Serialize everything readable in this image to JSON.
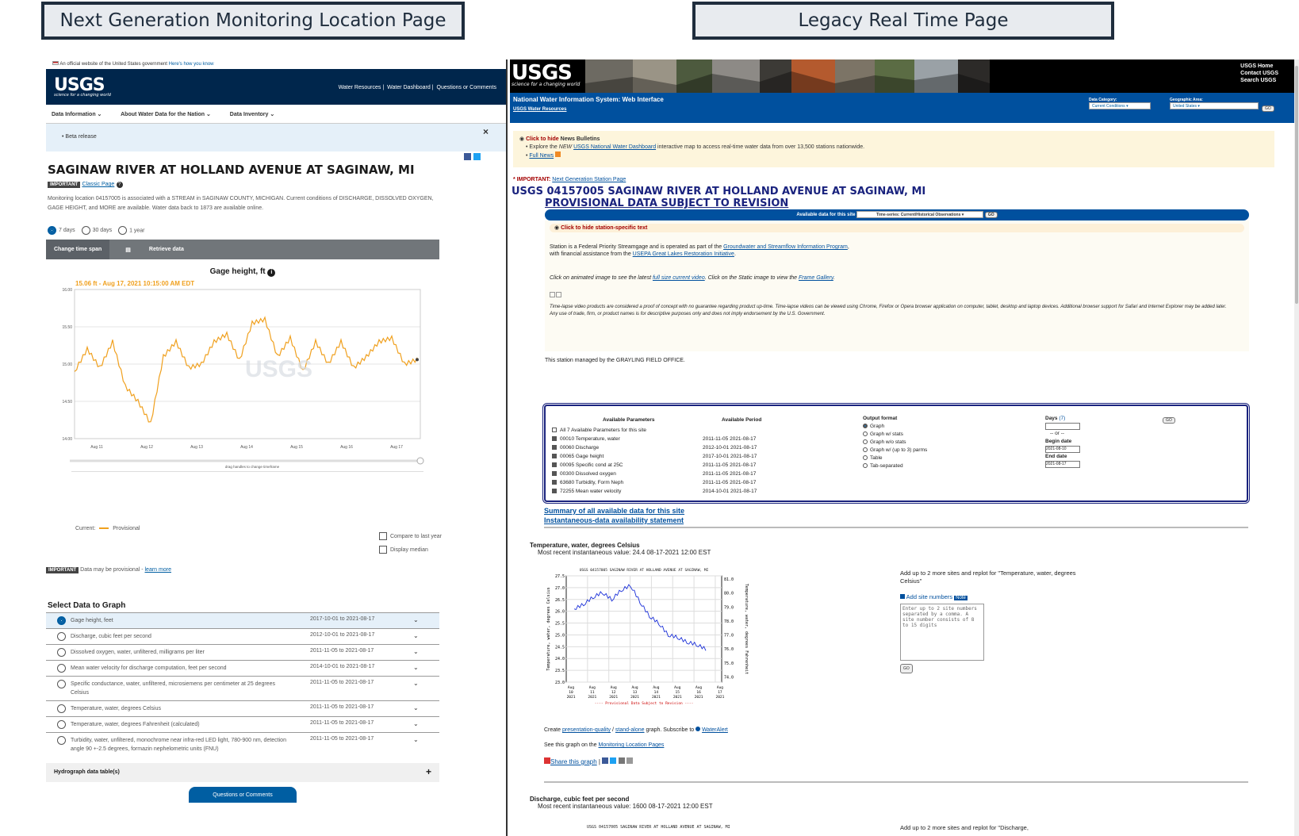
{
  "header_titles": {
    "left": "Next Generation Monitoring Location Page",
    "right": "Legacy Real Time Page"
  },
  "left": {
    "gov_banner": "An official website of the United States government",
    "gov_link": "Here's how you know",
    "logo": "USGS",
    "tagline": "science for a changing world",
    "header_links": [
      "Water Resources",
      "Water Dashboard",
      "Questions or Comments"
    ],
    "sub_nav": [
      "Data Information ⌄",
      "About Water Data for the Nation ⌄",
      "Data Inventory ⌄"
    ],
    "beta": "Beta release",
    "close": "×",
    "title": "SAGINAW RIVER AT HOLLAND AVENUE AT SAGINAW, MI",
    "important": "IMPORTANT",
    "classic_link": "Classic Page",
    "description": "Monitoring location 04157005 is associated with a STREAM in SAGINAW COUNTY, MICHIGAN. Current conditions of DISCHARGE, DISSOLVED OXYGEN, GAGE HEIGHT, and MORE are available. Water data back to 1873 are available online.",
    "time_options": [
      "7 days",
      "30 days",
      "1 year"
    ],
    "change_span": "Change time span",
    "retrieve": "Retrieve data",
    "graph_title": "Gage height, ft",
    "tooltip": "15.06 ft - Aug 17, 2021 10:15:00 AM EDT",
    "y_ticks": [
      "16.00",
      "15.50",
      "15.00",
      "14.50",
      "14.00"
    ],
    "x_ticks": [
      "Aug 11",
      "Aug 12",
      "Aug 13",
      "Aug 14",
      "Aug 15",
      "Aug 16",
      "Aug 17"
    ],
    "drag_hint": "drag handles to change timeframe",
    "legend_current": "Current:",
    "legend_provisional": "Provisional",
    "compare": "Compare to last year",
    "median": "Display median",
    "provisional_note": "Data may be provisional -",
    "learn_more": "learn more",
    "select_heading": "Select Data to Graph",
    "params": [
      {
        "name": "Gage height, feet",
        "period": "2017-10-01 to 2021-08-17"
      },
      {
        "name": "Discharge, cubic feet per second",
        "period": "2012-10-01 to 2021-08-17"
      },
      {
        "name": "Dissolved oxygen, water, unfiltered, milligrams per liter",
        "period": "2011-11-05 to 2021-08-17"
      },
      {
        "name": "Mean water velocity for discharge computation, feet per second",
        "period": "2014-10-01 to 2021-08-17"
      },
      {
        "name": "Specific conductance, water, unfiltered, microsiemens per centimeter at 25 degrees Celsius",
        "period": "2011-11-05 to 2021-08-17"
      },
      {
        "name": "Temperature, water, degrees Celsius",
        "period": "2011-11-05 to 2021-08-17"
      },
      {
        "name": "Temperature, water, degrees Fahrenheit (calculated)",
        "period": "2011-11-05 to 2021-08-17"
      },
      {
        "name": "Turbidity, water, unfiltered, monochrome near infra-red LED light, 780-900 nm, detection angle 90 +-2.5 degrees, formazin nephelometric units (FNU)",
        "period": "2011-11-05 to 2021-08-17"
      }
    ],
    "hydrograph": "Hydrograph data table(s)",
    "questions": "Questions or Comments",
    "colors": {
      "navy": "#00264c",
      "line": "#f0a01e",
      "accent": "#005ea2"
    }
  },
  "right": {
    "logo": "USGS",
    "tagline": "science for a changing world",
    "top_links": [
      "USGS Home",
      "Contact USGS",
      "Search USGS"
    ],
    "nwis": "National Water Information System: Web Interface",
    "water_resources": "USGS Water Resources",
    "data_category_label": "Data Category:",
    "data_category": "Current Conditions",
    "geo_label": "Geographic Area:",
    "geo": "United States",
    "go": "GO",
    "news_toggle": "Click to hide",
    "news_label": "News Bulletins",
    "news_1a": "Explore the",
    "news_1b": "NEW",
    "news_1c": "USGS National Water Dashboard",
    "news_1d": "interactive map to access real-time water data from over 13,500 stations nationwide.",
    "news_full": "Full News",
    "important": "* IMPORTANT:",
    "next_gen": "Next Generation Station Page",
    "station_title": "USGS 04157005 SAGINAW RIVER AT HOLLAND AVENUE AT SAGINAW, MI",
    "provisional": "PROVISIONAL DATA SUBJECT TO REVISION",
    "available_label": "Available data for this site",
    "available_select": "Time-series: Current/Historical Observations",
    "hide_station": "Click to hide station-specific text",
    "station_text_1": "Station is a Federal Priority Streamgage and is operated as part of the",
    "station_link_1": "Groundwater and Streamflow Information Program",
    "station_text_2": "with financial assistance from the",
    "station_link_2": "USEPA Great Lakes Restoration Initiative",
    "animated_1": "Click on animated image to see the latest",
    "animated_link": "full size current video",
    "animated_2": ". Click on the Static image to view the",
    "frame_link": "Frame Gallery",
    "disclaimer": "Time-lapse video products are considered a proof of concept with no guarantee regarding product up-time. Time-lapse videos can be viewed using Chrome, Firefox or Opera browser application on computer, tablet, desktop and laptop devices. Additional browser support for Safari and Internet Explorer may be added later. Any use of trade, firm, or product names is for descriptive purposes only and does not imply endorsement by the U.S. Government.",
    "managed": "This station managed by the GRAYLING FIELD OFFICE.",
    "table_headers": [
      "Available Parameters",
      "Available Period"
    ],
    "all_params": "All 7 Available Parameters for this site",
    "table_rows": [
      {
        "code": "00010 Temperature, water",
        "period": "2011-11-05  2021-08-17"
      },
      {
        "code": "00060 Discharge",
        "period": "2012-10-01  2021-08-17"
      },
      {
        "code": "00065 Gage height",
        "period": "2017-10-01  2021-08-17"
      },
      {
        "code": "00095 Specific cond at 25C",
        "period": "2011-11-05  2021-08-17"
      },
      {
        "code": "00300 Dissolved oxygen",
        "period": "2011-11-05  2021-08-17"
      },
      {
        "code": "63680 Turbidity, Form Neph",
        "period": "2011-11-05  2021-08-17"
      },
      {
        "code": "72255 Mean water velocity",
        "period": "2014-10-01  2021-08-17"
      }
    ],
    "output_format": "Output format",
    "formats": [
      "Graph",
      "Graph w/ stats",
      "Graph w/o stats",
      "Graph w/ (up to 3) parms",
      "Table",
      "Tab-separated"
    ],
    "days_label": "Days",
    "days_hint": "(7)",
    "or": "-- or --",
    "begin_label": "Begin date",
    "begin": "2021-08-10",
    "end_label": "End date",
    "end": "2021-08-17",
    "summary_link": "Summary of all available data for this site",
    "inst_link": "Instantaneous-data availability statement",
    "temp_title": "Temperature, water, degrees Celsius",
    "temp_recent": "Most recent instantaneous value: 24.4  08-17-2021    12:00 EST",
    "temp_chart_title": "USGS 04157005 SAGINAW RIVER AT HOLLAND AVENUE AT SAGINAW, MI",
    "temp_ylabel_left": "Temperature, water, degrees Celsius",
    "temp_ylabel_right": "Temperature, water, degrees Fahrenheit",
    "temp_y_left": [
      "27.5",
      "27.0",
      "26.5",
      "26.0",
      "25.5",
      "25.0",
      "24.5",
      "24.0",
      "23.5",
      "23.0"
    ],
    "temp_y_right": [
      "81.0",
      "80.0",
      "79.0",
      "78.0",
      "77.0",
      "76.0",
      "75.0",
      "74.0"
    ],
    "temp_x": [
      [
        "Aug",
        "10",
        "2021"
      ],
      [
        "Aug",
        "11",
        "2021"
      ],
      [
        "Aug",
        "12",
        "2021"
      ],
      [
        "Aug",
        "13",
        "2021"
      ],
      [
        "Aug",
        "14",
        "2021"
      ],
      [
        "Aug",
        "15",
        "2021"
      ],
      [
        "Aug",
        "16",
        "2021"
      ],
      [
        "Aug",
        "17",
        "2021"
      ]
    ],
    "prov_note": "---- Provisional Data Subject to Revision ----",
    "create_1": "Create",
    "create_link1": "presentation-quality",
    "create_sep": "/",
    "create_link2": "stand-alone",
    "create_2": "graph.   Subscribe to",
    "wateralert": "WaterAlert",
    "see_graph": "See this graph on the",
    "mlp_link": "Monitoring Location Pages",
    "share": "Share this graph",
    "add_sites_1": "Add up to 2 more sites and replot for \"Temperature, water, degrees Celsius\"",
    "add_site_numbers": "Add site numbers",
    "note": "Note",
    "textarea_placeholder": "Enter up to 2 site numbers separated by a comma. A site number consists of 8 to 15 digits",
    "disch_title": "Discharge, cubic feet per second",
    "disch_recent": "Most recent instantaneous value: 1600  08-17-2021    12:00 EST",
    "disch_chart_title": "USGS 04157005 SAGINAW RIVER AT HOLLAND AVENUE AT SAGINAW, MI",
    "add_sites_2": "Add up to 2 more sites and replot for \"Discharge,",
    "colors": {
      "blue": "#00509e",
      "title": "#1a237e",
      "news": "#fdf5dc"
    }
  },
  "chart_data": [
    {
      "type": "line",
      "title": "Gage height, ft",
      "x": [
        "Aug 10 12:00",
        "Aug 11",
        "Aug 11 06:00",
        "Aug 11 12:00",
        "Aug 11 18:00",
        "Aug 12",
        "Aug 12 06:00",
        "Aug 12 12:00",
        "Aug 12 18:00",
        "Aug 13",
        "Aug 13 06:00",
        "Aug 13 12:00",
        "Aug 13 18:00",
        "Aug 14",
        "Aug 14 06:00",
        "Aug 14 12:00",
        "Aug 14 18:00",
        "Aug 15",
        "Aug 15 06:00",
        "Aug 15 12:00",
        "Aug 15 18:00",
        "Aug 16",
        "Aug 16 06:00",
        "Aug 16 12:00",
        "Aug 16 18:00",
        "Aug 17",
        "Aug 17 06:00",
        "Aug 17 10:15"
      ],
      "values": [
        14.9,
        15.2,
        14.95,
        15.3,
        14.7,
        14.5,
        14.2,
        15.1,
        15.3,
        14.95,
        15.0,
        15.3,
        15.4,
        15.05,
        15.55,
        15.6,
        15.1,
        15.35,
        14.9,
        15.3,
        15.0,
        15.3,
        14.95,
        15.1,
        15.3,
        15.35,
        15.0,
        15.06
      ],
      "ylim": [
        14.0,
        16.0
      ],
      "series_color": "#f0a01e"
    },
    {
      "type": "line",
      "title": "USGS 04157005 SAGINAW RIVER AT HOLLAND AVENUE AT SAGINAW, MI",
      "ylabel": "Temperature, water, degrees Celsius",
      "x": [
        "Aug 10",
        "Aug 10 12:00",
        "Aug 11",
        "Aug 11 12:00",
        "Aug 12",
        "Aug 12 12:00",
        "Aug 13",
        "Aug 13 12:00",
        "Aug 14",
        "Aug 14 12:00",
        "Aug 15",
        "Aug 15 12:00",
        "Aug 16",
        "Aug 16 12:00",
        "Aug 17"
      ],
      "values": [
        26.1,
        26.3,
        26.6,
        26.8,
        26.5,
        26.9,
        27.1,
        26.4,
        25.8,
        25.5,
        25.0,
        24.9,
        24.7,
        24.6,
        24.4
      ],
      "ylim": [
        23.0,
        27.5
      ]
    }
  ]
}
